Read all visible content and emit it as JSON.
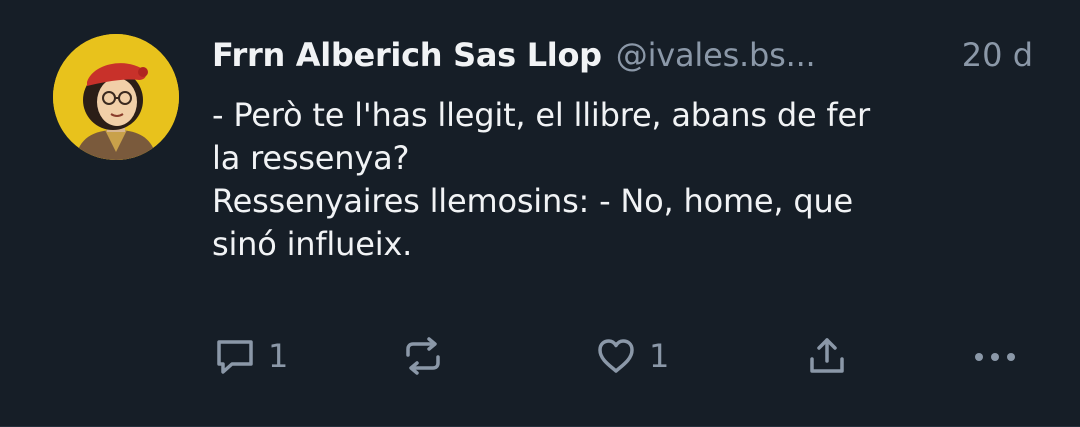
{
  "post": {
    "author": {
      "display_name": "Frrn Alberich Sas Llop",
      "handle": "@ivales.bs..."
    },
    "timestamp": "20 d",
    "text_lines": [
      "- Però te l'has llegit, el llibre, abans de fer",
      "la ressenya?",
      "Ressenyaires llemosins: - No, home, que",
      "sinó influeix."
    ],
    "stats": {
      "replies": "1",
      "likes": "1"
    }
  },
  "colors": {
    "background": "#161e27",
    "text_primary": "#f1f3f5",
    "text_secondary": "#8b98a8",
    "avatar_bg": "#e8c21c"
  },
  "icons": {
    "reply": "speech-bubble-icon",
    "repost": "repost-arrows-icon",
    "like": "heart-icon",
    "share": "share-upload-icon",
    "more": "ellipsis-icon"
  }
}
